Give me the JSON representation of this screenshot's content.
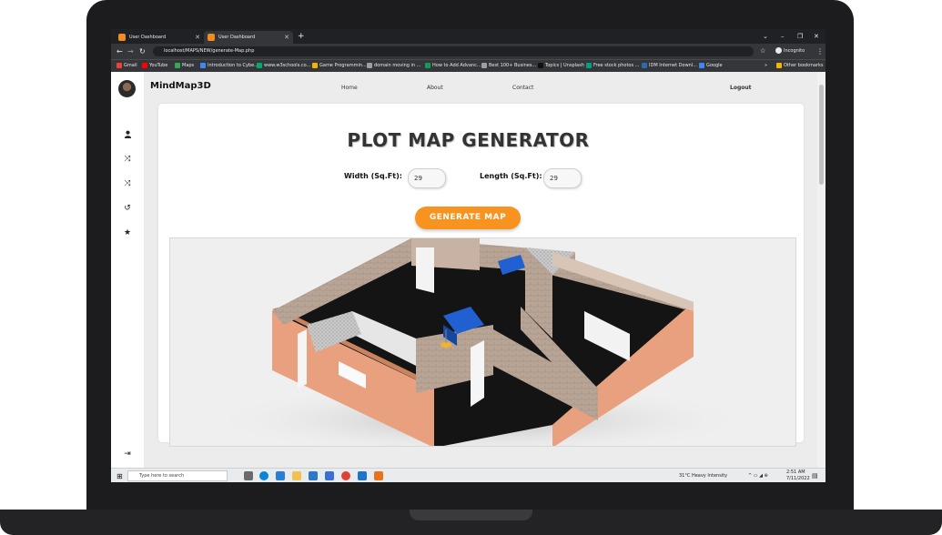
{
  "browser": {
    "tabs": [
      {
        "title": "User Dashboard"
      },
      {
        "title": "User Dashboard"
      }
    ],
    "new_tab_symbol": "+",
    "window_controls": [
      "⌄",
      "–",
      "❐",
      "✕"
    ],
    "url": "localhost/MAPS/NEW/generate-Map.php",
    "profile_label": "Incognito",
    "bookmarks": [
      {
        "label": "Gmail",
        "color": "#ea4335"
      },
      {
        "label": "YouTube",
        "color": "#ff0000"
      },
      {
        "label": "Maps",
        "color": "#34a853"
      },
      {
        "label": "Introduction to Cybe...",
        "color": "#4285f4"
      },
      {
        "label": "www.w3schools.co...",
        "color": "#04aa6d"
      },
      {
        "label": "Game Programmin...",
        "color": "#f4b400"
      },
      {
        "label": "domain moving in ...",
        "color": "#9aa0a6"
      },
      {
        "label": "How to Add Advanc...",
        "color": "#0f9d58"
      },
      {
        "label": "Best 100+ Busines...",
        "color": "#9aa0a6"
      },
      {
        "label": "Topics | Unsplash",
        "color": "#111111"
      },
      {
        "label": "Free stock photos ...",
        "color": "#05a081"
      },
      {
        "label": "IDM Internet Downl...",
        "color": "#2b6cb0"
      },
      {
        "label": "Google",
        "color": "#4285f4"
      }
    ],
    "bookmarks_more": "»",
    "other_bookmarks": "Other bookmarks"
  },
  "app": {
    "brand": "MindMap3D",
    "nav": {
      "home": "Home",
      "about": "About",
      "contact": "Contact",
      "logout": "Logout"
    },
    "sidebar_icons": [
      "user-icon",
      "shuffle-icon",
      "shuffle-icon",
      "history-icon",
      "star-icon",
      "logout-icon"
    ]
  },
  "generator": {
    "title": "PLOT MAP GENERATOR",
    "width_label": "Width (Sq.Ft):",
    "width_value": "29",
    "length_label": "Length (Sq.Ft):",
    "length_value": "29",
    "button_label": "GENERATE MAP"
  },
  "taskbar": {
    "search_placeholder": "Type here to search",
    "weather": "31°C  Heavy Intensity",
    "time": "2:51 AM",
    "date": "7/11/2022"
  },
  "colors": {
    "accent": "#f7931e",
    "wall_exterior": "#e8a07f",
    "wall_brick": "#b9a89a",
    "floor": "#111111",
    "sofa": "#2060d0"
  }
}
